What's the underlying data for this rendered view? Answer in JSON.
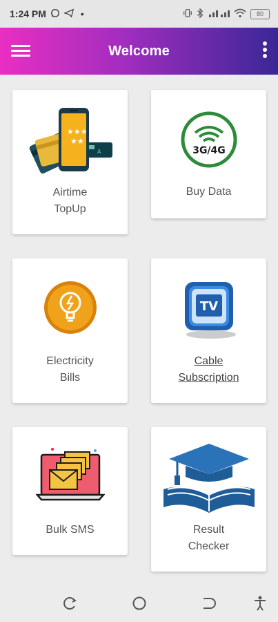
{
  "status_bar": {
    "time": "1:24 PM",
    "dot": "•",
    "right_icons": [
      "vibrate-icon",
      "bluetooth-icon",
      "signal-icon",
      "wifi-icon",
      "battery-icon"
    ],
    "battery": "80"
  },
  "app_bar": {
    "title": "Welcome",
    "menu_icon": "hamburger-menu-icon",
    "overflow_icon": "more-vertical-icon",
    "gradient": [
      "#e92fc2",
      "#a12dbf",
      "#3a2796"
    ]
  },
  "cards": [
    {
      "label_line1": "Airtime",
      "label_line2": "TopUp",
      "icon": "airtime-phone-cards-icon"
    },
    {
      "label_line1": "Buy Data",
      "label_line2": "",
      "icon": "wifi-3g-4g-icon",
      "badge": "3G/4G"
    },
    {
      "label_line1": "Electricity",
      "label_line2": "Bills",
      "icon": "lightbulb-icon"
    },
    {
      "label_line1": "Cable",
      "label_line2": "Subscription",
      "icon": "tv-icon",
      "badge": "TV"
    },
    {
      "label_line1": "Bulk SMS",
      "label_line2": "",
      "icon": "laptop-envelopes-icon"
    },
    {
      "label_line1": "Result",
      "label_line2": "Checker",
      "icon": "graduation-cap-book-icon"
    }
  ],
  "nav_bar": {
    "icons": [
      "recent-apps-icon",
      "home-icon",
      "back-icon",
      "accessibility-icon"
    ]
  }
}
